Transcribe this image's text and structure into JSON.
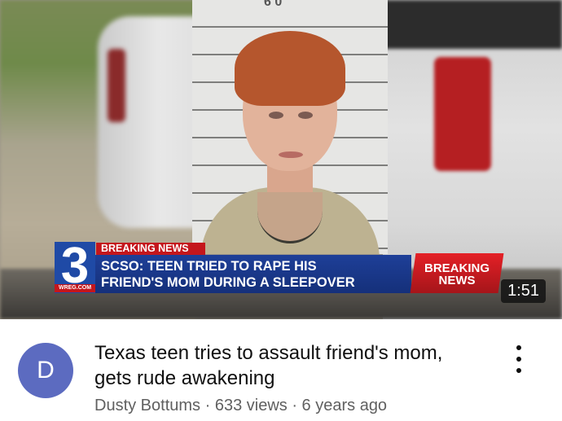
{
  "thumbnail": {
    "mugshot_number": "6 0",
    "station_number": "3",
    "station_site": "WREG.COM",
    "breaking_tag": "BREAKING NEWS",
    "headline_line1": "SCSO: TEEN TRIED TO RAPE HIS",
    "headline_line2": "FRIEND'S MOM DURING A SLEEPOVER",
    "badge_line1": "BREAKING",
    "badge_line2": "NEWS",
    "duration": "1:51"
  },
  "video": {
    "avatar_letter": "D",
    "title": "Texas teen tries to assault friend's mom, gets rude awakening",
    "channel": "Dusty Bottums",
    "views": "633 views",
    "age": "6 years ago",
    "separator": " · ",
    "menu_icon": "more-vert-icon"
  },
  "colors": {
    "avatar_bg": "#5c6bc0",
    "news_red": "#c4161c",
    "news_blue": "#1e3f98"
  }
}
